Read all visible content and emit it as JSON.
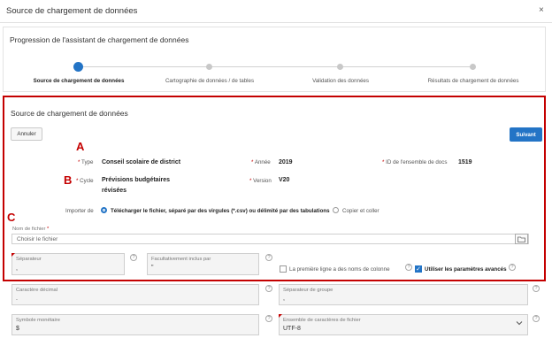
{
  "window": {
    "title": "Source de chargement de données",
    "close_symbol": "×"
  },
  "wizard": {
    "title": "Progression de l'assistant de chargement de données",
    "steps": [
      {
        "label": "Source de chargement de données"
      },
      {
        "label": "Cartographie de données / de tables"
      },
      {
        "label": "Validation des données"
      },
      {
        "label": "Résultats de chargement de données"
      }
    ],
    "active_step": 1
  },
  "panel": {
    "title": "Source de chargement de données",
    "cancel_label": "Annuler",
    "next_label": "Suivant",
    "markers": {
      "a": "A",
      "b": "B",
      "c": "C"
    }
  },
  "details": {
    "type_label": "Type",
    "type_value": "Conseil scolaire de district",
    "annee_label": "Année",
    "annee_value": "2019",
    "docset_label": "ID de l'ensemble de docs",
    "docset_value": "1519",
    "cycle_label": "Cycle",
    "cycle_value_line1": "Prévisions budgétaires",
    "cycle_value_line2": "révisées",
    "version_label": "Version",
    "version_value": "V20",
    "required_mark": "*"
  },
  "import": {
    "label": "Importer de",
    "option_upload": "Télécharger le fichier, séparé par des virgules (*.csv) ou délimité par des tabulations",
    "option_paste": "Copier et coller",
    "selected": "upload"
  },
  "file": {
    "label": "Nom de fichier",
    "required_mark": "*",
    "placeholder": "Choisir le fichier"
  },
  "fields": {
    "separator_label": "Séparateur",
    "separator_value": ",",
    "enclosed_label": "Facultativement inclus par",
    "enclosed_value": "\"",
    "first_row_label": "La première ligne a des noms de colonne",
    "first_row_checked": false,
    "advanced_label": "Utiliser les paramètres avancés",
    "advanced_checked": true,
    "check_mark": "✓",
    "decimal_label": "Caractère décimal",
    "decimal_value": ".",
    "group_label": "Séparateur de groupe",
    "group_value": ",",
    "currency_label": "Symbole monétaire",
    "currency_value": "$",
    "charset_label": "Ensemble de caractères de fichier",
    "charset_value": "UTF-8",
    "help_symbol": "?"
  },
  "colors": {
    "accent": "#2374c6",
    "highlight": "#c40000"
  }
}
